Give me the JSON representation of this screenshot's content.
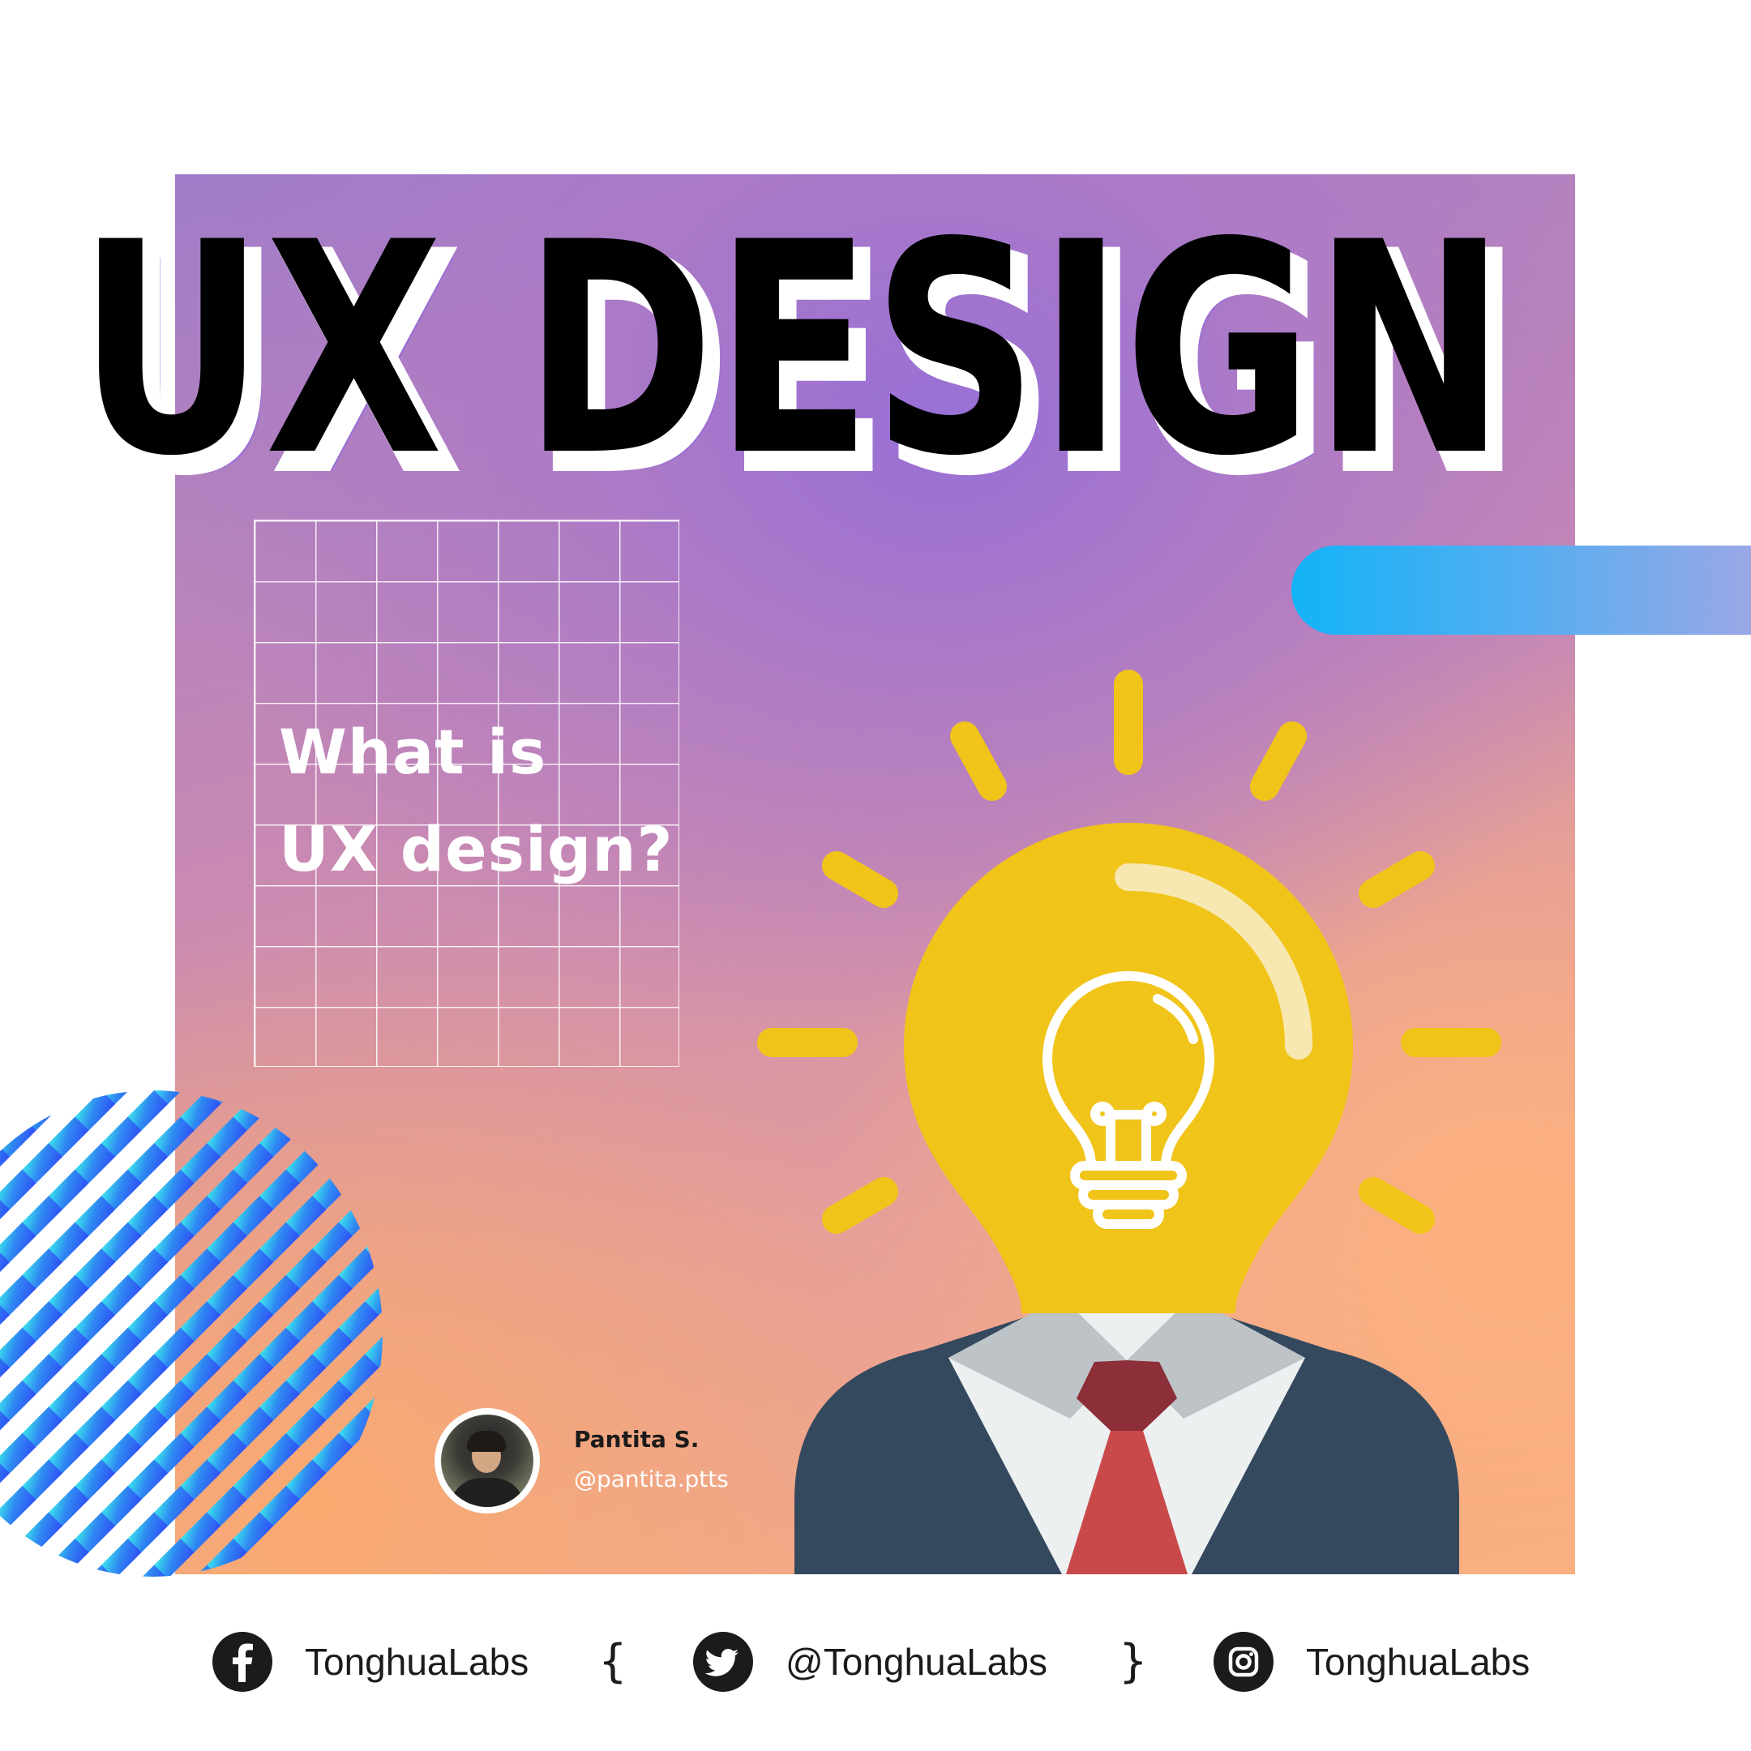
{
  "headline": {
    "title": "UX DESIGN",
    "fill_color": "#000000",
    "shadow_colors": [
      "#ffffff",
      "#9b6fd6"
    ]
  },
  "question": {
    "line1": "What is",
    "line2": "UX design?"
  },
  "author": {
    "name": "Pantita S.",
    "handle": "@pantita.ptts"
  },
  "footer": {
    "facebook": {
      "icon": "facebook-icon",
      "label": "TonghuaLabs"
    },
    "open_brace": "{",
    "twitter": {
      "icon": "twitter-icon",
      "label": "@TonghuaLabs"
    },
    "close_brace": "}",
    "instagram": {
      "icon": "instagram-icon",
      "label": "TonghuaLabs"
    }
  },
  "colors": {
    "bulb_yellow": "#f0c419",
    "suit_navy": "#34495e",
    "tie_red": "#c9494b",
    "accent_blue": "#13b3f7",
    "stripe_blue": "#2f5cf5",
    "stripe_cyan": "#3be0ec"
  }
}
